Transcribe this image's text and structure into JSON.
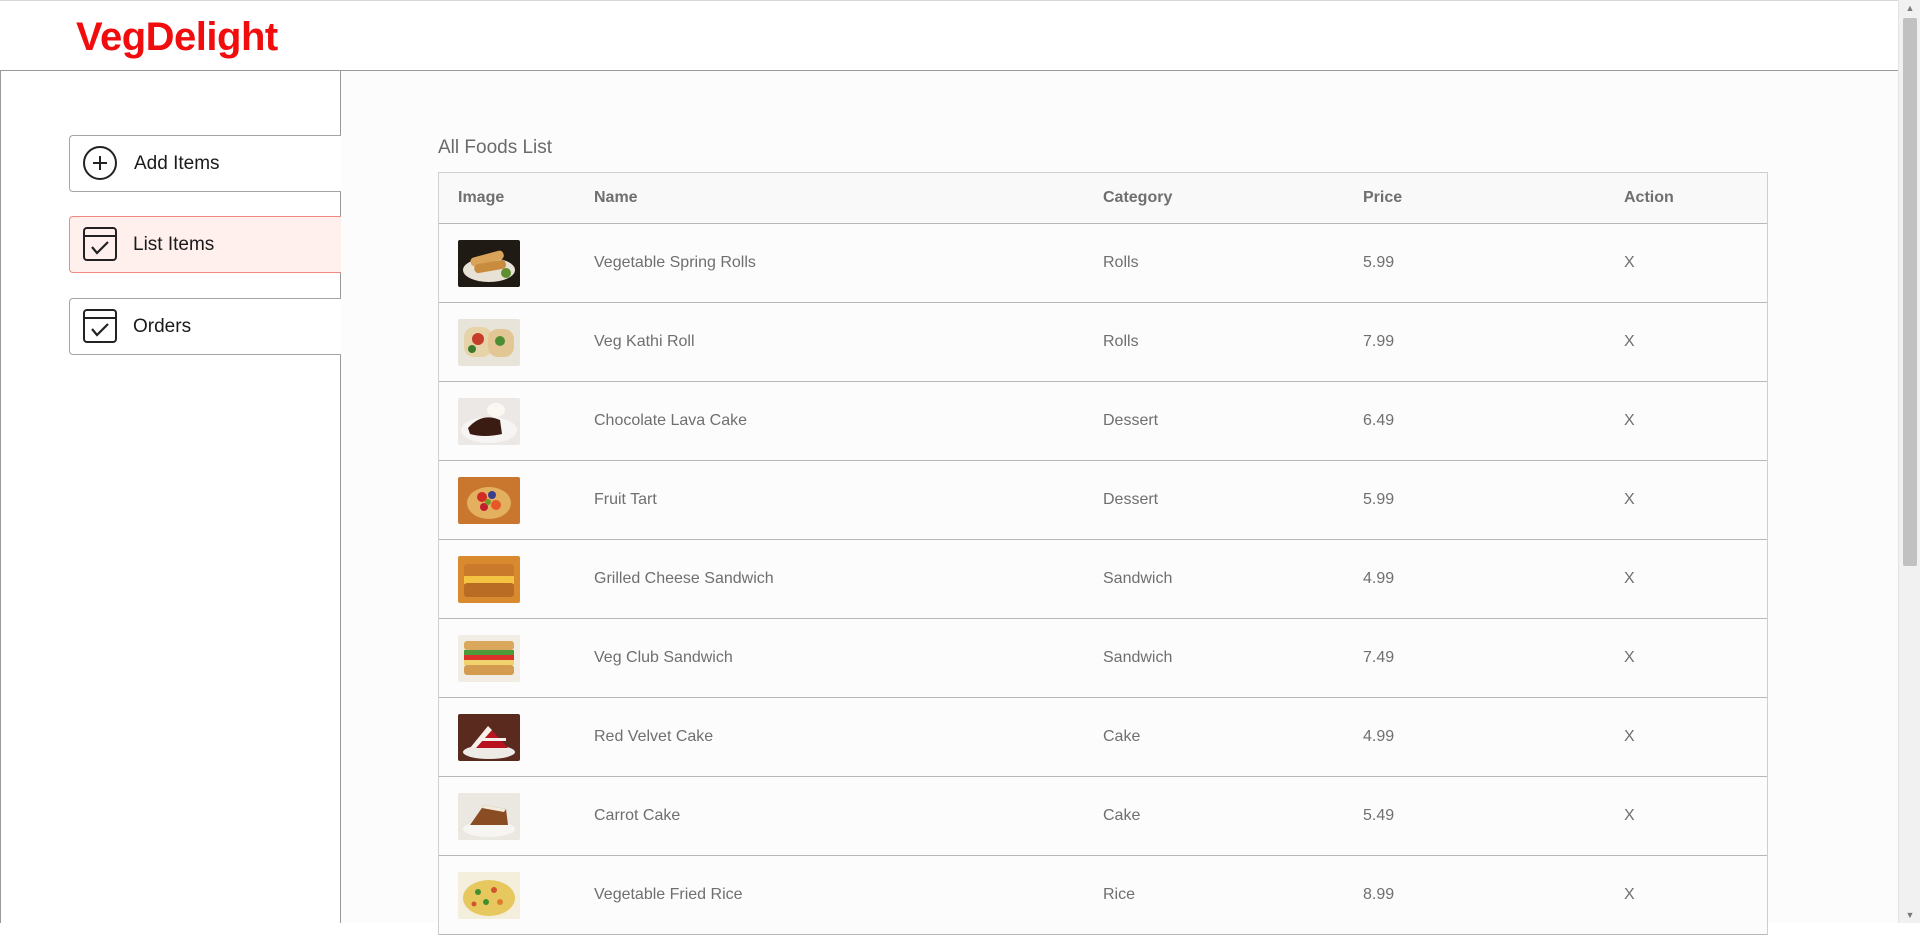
{
  "brand": {
    "logo": "VegDelight",
    "color": "#f10d0d"
  },
  "sidebar": {
    "items": [
      {
        "label": "Add Items",
        "icon": "plus-circle-icon",
        "active": false
      },
      {
        "label": "List Items",
        "icon": "checklist-icon",
        "active": true
      },
      {
        "label": "Orders",
        "icon": "checklist-icon",
        "active": false
      }
    ]
  },
  "main": {
    "title": "All Foods List",
    "columns": [
      "Image",
      "Name",
      "Category",
      "Price",
      "Action"
    ],
    "rows": [
      {
        "name": "Vegetable Spring Rolls",
        "category": "Rolls",
        "price": "5.99",
        "action": "X",
        "image_icon": "spring-rolls-photo"
      },
      {
        "name": "Veg Kathi Roll",
        "category": "Rolls",
        "price": "7.99",
        "action": "X",
        "image_icon": "kathi-roll-photo"
      },
      {
        "name": "Chocolate Lava Cake",
        "category": "Dessert",
        "price": "6.49",
        "action": "X",
        "image_icon": "lava-cake-photo"
      },
      {
        "name": "Fruit Tart",
        "category": "Dessert",
        "price": "5.99",
        "action": "X",
        "image_icon": "fruit-tart-photo"
      },
      {
        "name": "Grilled Cheese Sandwich",
        "category": "Sandwich",
        "price": "4.99",
        "action": "X",
        "image_icon": "grilled-cheese-photo"
      },
      {
        "name": "Veg Club Sandwich",
        "category": "Sandwich",
        "price": "7.49",
        "action": "X",
        "image_icon": "club-sandwich-photo"
      },
      {
        "name": "Red Velvet Cake",
        "category": "Cake",
        "price": "4.99",
        "action": "X",
        "image_icon": "red-velvet-photo"
      },
      {
        "name": "Carrot Cake",
        "category": "Cake",
        "price": "5.49",
        "action": "X",
        "image_icon": "carrot-cake-photo"
      },
      {
        "name": "Vegetable Fried Rice",
        "category": "Rice",
        "price": "8.99",
        "action": "X",
        "image_icon": "fried-rice-photo"
      }
    ]
  }
}
